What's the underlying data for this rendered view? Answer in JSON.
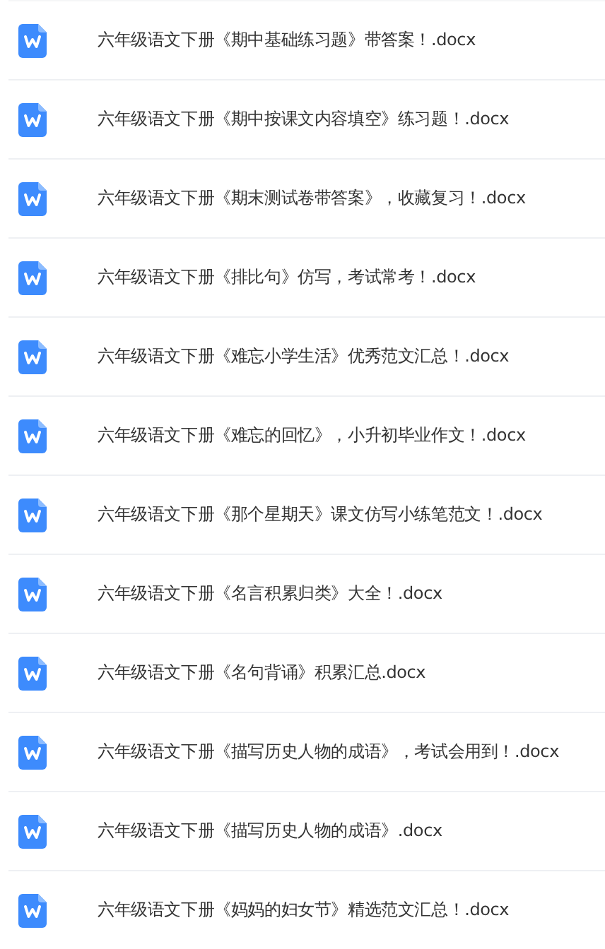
{
  "files": [
    {
      "name": "六年级语文下册《期中基础练习题》带答案！.docx"
    },
    {
      "name": "六年级语文下册《期中按课文内容填空》练习题！.docx"
    },
    {
      "name": "六年级语文下册《期末测试卷带答案》，收藏复习！.docx"
    },
    {
      "name": "六年级语文下册《排比句》仿写，考试常考！.docx"
    },
    {
      "name": "六年级语文下册《难忘小学生活》优秀范文汇总！.docx"
    },
    {
      "name": "六年级语文下册《难忘的回忆》，小升初毕业作文！.docx"
    },
    {
      "name": "六年级语文下册《那个星期天》课文仿写小练笔范文！.docx"
    },
    {
      "name": "六年级语文下册《名言积累归类》大全！.docx"
    },
    {
      "name": "六年级语文下册《名句背诵》积累汇总.docx"
    },
    {
      "name": "六年级语文下册《描写历史人物的成语》，考试会用到！.docx"
    },
    {
      "name": "六年级语文下册《描写历史人物的成语》.docx"
    },
    {
      "name": "六年级语文下册《妈妈的妇女节》精选范文汇总！.docx"
    }
  ]
}
